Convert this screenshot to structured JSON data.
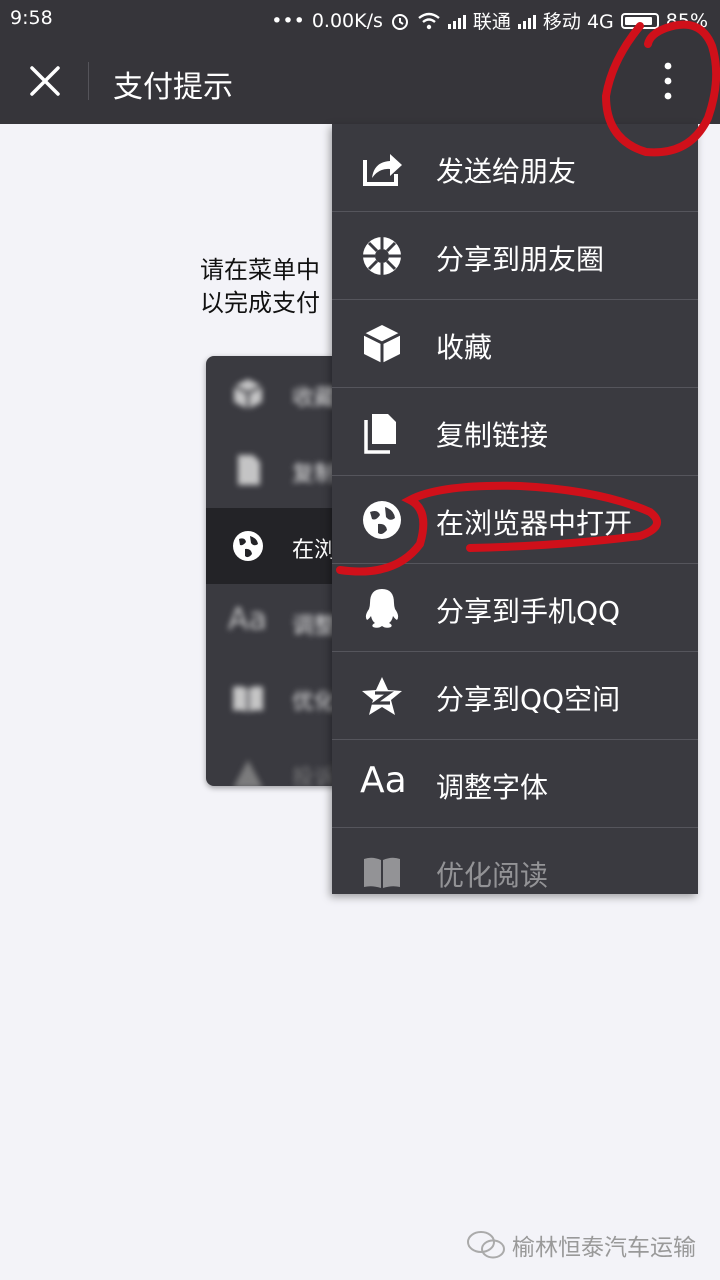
{
  "status_bar": {
    "time": "9:58",
    "net_speed": "0.00K/s",
    "carrier1": "联通",
    "carrier2": "移动 4G",
    "battery": "85%"
  },
  "title_bar": {
    "title": "支付提示"
  },
  "content": {
    "instruction_line1": "请在菜单中",
    "instruction_line2": "以完成支付",
    "example_menu": [
      {
        "icon": "cube-icon",
        "label": "收藏"
      },
      {
        "icon": "document-icon",
        "label": "复制"
      },
      {
        "icon": "globe-icon",
        "label": "在浏"
      },
      {
        "icon": "font-icon",
        "label": "调整"
      },
      {
        "icon": "book-icon",
        "label": "优化"
      },
      {
        "icon": "warning-icon",
        "label": "投诉"
      }
    ]
  },
  "menu": {
    "items": [
      {
        "icon": "share-icon",
        "label": "发送给朋友"
      },
      {
        "icon": "moments-icon",
        "label": "分享到朋友圈"
      },
      {
        "icon": "cube-icon",
        "label": "收藏"
      },
      {
        "icon": "copy-link-icon",
        "label": "复制链接"
      },
      {
        "icon": "globe-icon",
        "label": "在浏览器中打开"
      },
      {
        "icon": "qq-icon",
        "label": "分享到手机QQ"
      },
      {
        "icon": "qzone-icon",
        "label": "分享到QQ空间"
      },
      {
        "icon": "font-size-icon",
        "label": "调整字体"
      },
      {
        "icon": "book-icon",
        "label": "优化阅读"
      }
    ]
  },
  "watermark": {
    "text": "榆林恒泰汽车运输"
  },
  "colors": {
    "bar": "#36353a",
    "menu": "#3a3a40",
    "annotation": "#d0101a"
  }
}
